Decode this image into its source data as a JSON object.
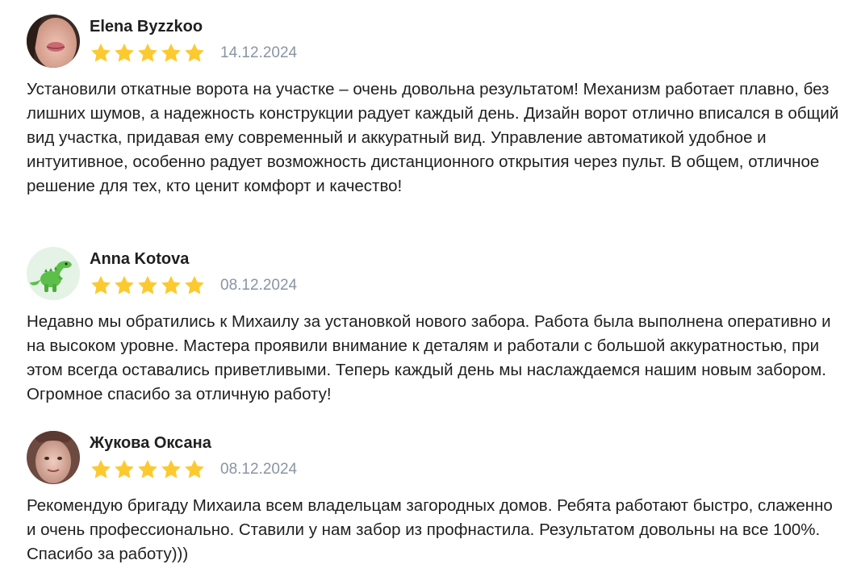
{
  "reviews": [
    {
      "author": "Elena Byzzkoo",
      "date": "14.12.2024",
      "rating": 5,
      "avatar_icon": "user-photo-icon",
      "text": "Установили откатные ворота на участке – очень довольна результатом! Механизм работает плавно, без лишних шумов, а надежность конструкции радует каждый день. Дизайн ворот отлично вписался в общий вид участка, придавая ему современный и аккуратный вид. Управление автоматикой удобное и интуитивное, особенно радует возможность дистанционного открытия через пульт. В общем, отличное решение для тех, кто ценит комфорт и качество!"
    },
    {
      "author": "Anna Kotova",
      "date": "08.12.2024",
      "rating": 5,
      "avatar_icon": "dinosaur-icon",
      "text": "Недавно мы обратились к Михаилу за установкой нового забора. Работа была выполнена оперативно и на высоком уровне. Мастера проявили внимание к деталям и работали с большой аккуратностью, при этом всегда оставались приветливыми. Теперь каждый день мы наслаждаемся нашим новым забором. Огромное спасибо за отличную работу!"
    },
    {
      "author": "Жукова Оксана",
      "date": "08.12.2024",
      "rating": 5,
      "avatar_icon": "user-photo-icon",
      "text": "Рекомендую бригаду Михаила всем владельцам загородных домов. Ребята работают быстро, слаженно и очень профессионально. Ставили у нам забор из профнастила. Результатом довольны на все 100%. Спасибо за работу)))"
    }
  ],
  "colors": {
    "star": "#fcca30",
    "date": "#8a94a3",
    "text": "#1f1f1f"
  }
}
